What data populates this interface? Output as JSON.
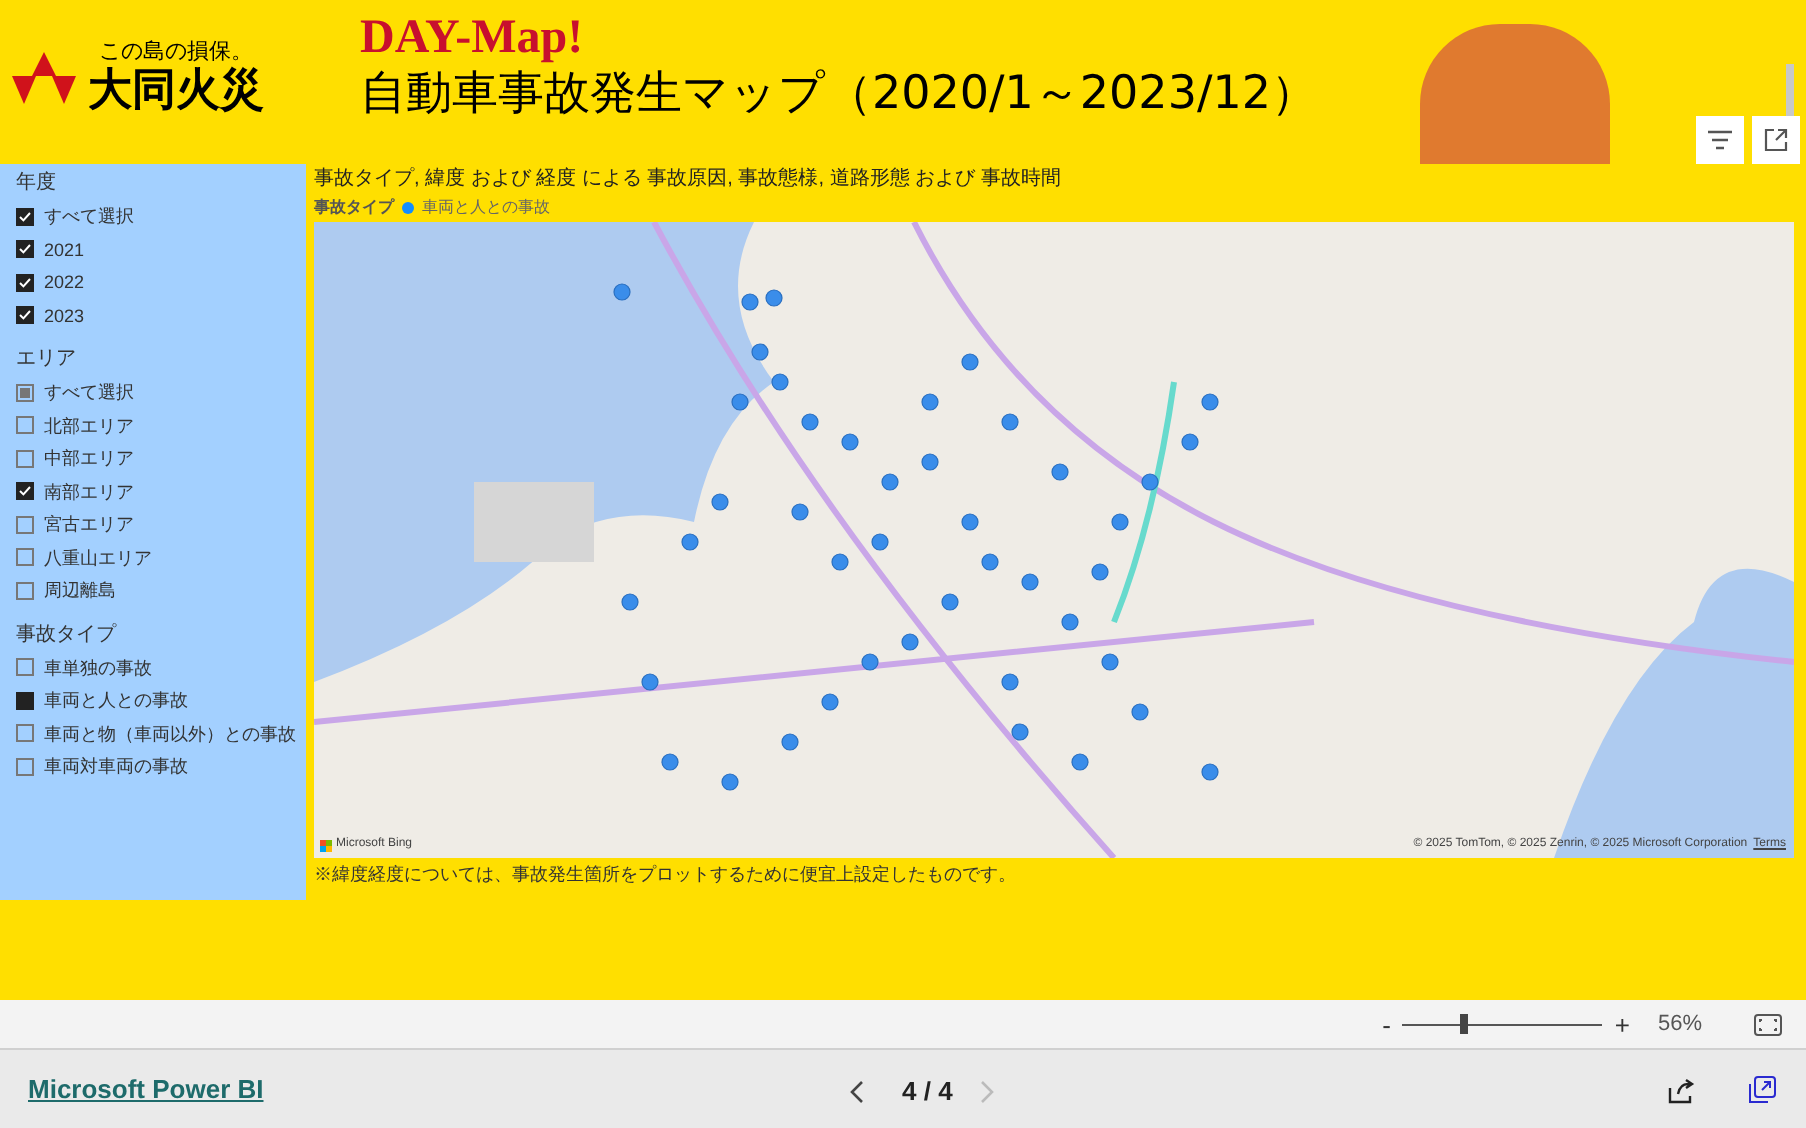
{
  "header": {
    "tagline": "この島の損保。",
    "brand": "大同火災",
    "subtitle": "DAY-Map!",
    "title": "自動車事故発生マップ（2020/1～2023/12）"
  },
  "filters": [
    {
      "heading": "年度",
      "kind": "multi",
      "items": [
        {
          "label": "すべて選択",
          "checked": true,
          "indeterminate": false
        },
        {
          "label": "2021",
          "checked": true,
          "indeterminate": false
        },
        {
          "label": "2022",
          "checked": true,
          "indeterminate": false
        },
        {
          "label": "2023",
          "checked": true,
          "indeterminate": false
        }
      ]
    },
    {
      "heading": "エリア",
      "kind": "multi",
      "items": [
        {
          "label": "すべて選択",
          "checked": false,
          "indeterminate": true
        },
        {
          "label": "北部エリア",
          "checked": false,
          "indeterminate": false
        },
        {
          "label": "中部エリア",
          "checked": false,
          "indeterminate": false
        },
        {
          "label": "南部エリア",
          "checked": true,
          "indeterminate": false
        },
        {
          "label": "宮古エリア",
          "checked": false,
          "indeterminate": false
        },
        {
          "label": "八重山エリア",
          "checked": false,
          "indeterminate": false
        },
        {
          "label": "周辺離島",
          "checked": false,
          "indeterminate": false
        }
      ]
    },
    {
      "heading": "事故タイプ",
      "kind": "single",
      "items": [
        {
          "label": "車単独の事故",
          "checked": false,
          "indeterminate": false
        },
        {
          "label": "車両と人との事故",
          "checked": true,
          "indeterminate": false
        },
        {
          "label": "車両と物（車両以外）との事故",
          "checked": false,
          "indeterminate": false
        },
        {
          "label": "車両対車両の事故",
          "checked": false,
          "indeterminate": false
        }
      ]
    }
  ],
  "map": {
    "title": "事故タイプ, 緯度 および 経度 による 事故原因, 事故態様, 道路形態 および 事故時間",
    "legend_title": "事故タイプ",
    "legend_items": [
      {
        "label": "車両と人との事故",
        "color": "#118dff"
      }
    ],
    "provider": "Microsoft Bing",
    "attribution": "© 2025 TomTom, © 2025 Zenrin, © 2025 Microsoft Corporation",
    "terms": "Terms",
    "note": "※緯度経度については、事故発生箇所をプロットするために便宜上設定したものです。"
  },
  "zoom": {
    "minus": "-",
    "plus": "+",
    "level": 0.3,
    "percent": "56%"
  },
  "footer": {
    "link": "Microsoft Power BI",
    "page": "4 / 4"
  }
}
